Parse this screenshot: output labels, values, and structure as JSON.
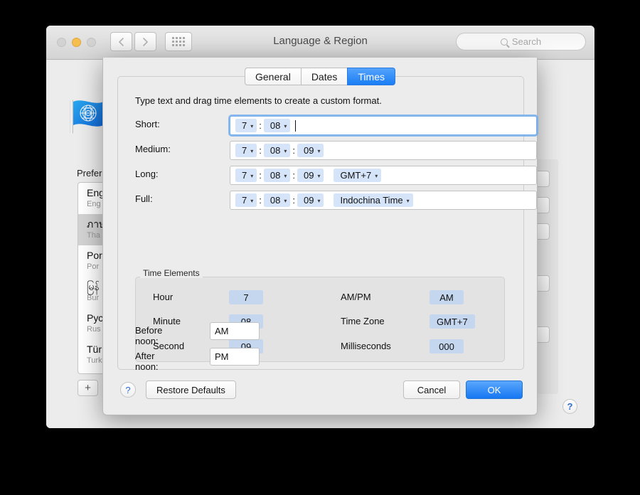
{
  "window": {
    "title": "Language & Region",
    "traffic_lights": [
      "close",
      "minimize",
      "zoom"
    ],
    "back_icon": "chevron-left-icon",
    "forward_icon": "chevron-right-icon",
    "grid_icon": "show-all-grid-icon",
    "search": {
      "placeholder": "Search",
      "icon": "search-icon",
      "value": ""
    }
  },
  "prefs": {
    "pane_icon": "un-flag-icon",
    "preferred_languages_label": "Preferred languages:",
    "languages": [
      {
        "native": "Eng",
        "english": "Eng",
        "selected": false
      },
      {
        "native": "ภาษ",
        "english": "Tha",
        "selected": true
      },
      {
        "native": "Por",
        "english": "Por",
        "selected": false
      },
      {
        "native": "မြန်",
        "english": "Bur",
        "selected": false
      },
      {
        "native": "Рус",
        "english": "Rus",
        "selected": false
      },
      {
        "native": "Tür",
        "english": "Turk",
        "selected": false
      }
    ],
    "add_button_label": "+",
    "help_label": "?"
  },
  "sheet": {
    "tabs": [
      {
        "label": "General",
        "active": false
      },
      {
        "label": "Dates",
        "active": false
      },
      {
        "label": "Times",
        "active": true
      }
    ],
    "hint": "Type text and drag time elements to create a custom format.",
    "formats": [
      {
        "label": "Short:",
        "focused": true,
        "parts": [
          {
            "kind": "token",
            "text": "7"
          },
          {
            "kind": "sep",
            "text": ":"
          },
          {
            "kind": "token",
            "text": "08"
          },
          {
            "kind": "caret"
          }
        ]
      },
      {
        "label": "Medium:",
        "focused": false,
        "parts": [
          {
            "kind": "token",
            "text": "7"
          },
          {
            "kind": "sep",
            "text": ":"
          },
          {
            "kind": "token",
            "text": "08"
          },
          {
            "kind": "sep",
            "text": ":"
          },
          {
            "kind": "token",
            "text": "09"
          }
        ]
      },
      {
        "label": "Long:",
        "focused": false,
        "parts": [
          {
            "kind": "token",
            "text": "7"
          },
          {
            "kind": "sep",
            "text": ":"
          },
          {
            "kind": "token",
            "text": "08"
          },
          {
            "kind": "sep",
            "text": ":"
          },
          {
            "kind": "token",
            "text": "09"
          },
          {
            "kind": "spacer"
          },
          {
            "kind": "token",
            "text": "GMT+7"
          }
        ]
      },
      {
        "label": "Full:",
        "focused": false,
        "parts": [
          {
            "kind": "token",
            "text": "7"
          },
          {
            "kind": "sep",
            "text": ":"
          },
          {
            "kind": "token",
            "text": "08"
          },
          {
            "kind": "sep",
            "text": ":"
          },
          {
            "kind": "token",
            "text": "09"
          },
          {
            "kind": "spacer"
          },
          {
            "kind": "token",
            "text": "Indochina Time"
          }
        ]
      }
    ],
    "time_elements": {
      "title": "Time Elements",
      "left": [
        {
          "name": "Hour",
          "value": "7"
        },
        {
          "name": "Minute",
          "value": "08"
        },
        {
          "name": "Second",
          "value": "09"
        }
      ],
      "right": [
        {
          "name": "AM/PM",
          "value": "AM"
        },
        {
          "name": "Time Zone",
          "value": "GMT+7"
        },
        {
          "name": "Milliseconds",
          "value": "000"
        }
      ]
    },
    "before_noon": {
      "label": "Before noon:",
      "value": "AM"
    },
    "after_noon": {
      "label": "After noon:",
      "value": "PM"
    },
    "footer": {
      "help_label": "?",
      "restore_label": "Restore Defaults",
      "cancel_label": "Cancel",
      "ok_label": "OK"
    }
  },
  "colors": {
    "accent_blue": "#1a7ef4",
    "token_blue": "#d5e4f8",
    "chip_blue": "#c5d7ef",
    "window_bg": "#ececec",
    "selected_row": "#d3d3d3"
  }
}
